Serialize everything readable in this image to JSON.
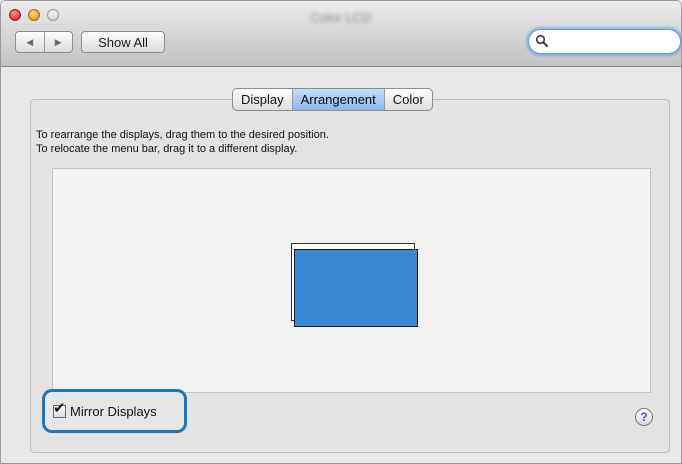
{
  "window": {
    "title": "Color LCD"
  },
  "toolbar": {
    "back_glyph": "◀",
    "forward_glyph": "▶",
    "show_all_label": "Show All",
    "search": {
      "value": "",
      "placeholder": ""
    }
  },
  "tabs": [
    {
      "label": "Display",
      "selected": false
    },
    {
      "label": "Arrangement",
      "selected": true
    },
    {
      "label": "Color",
      "selected": false
    }
  ],
  "instructions": {
    "line1": "To rearrange the displays, drag them to the desired position.",
    "line2": "To relocate the menu bar, drag it to a different display."
  },
  "arrangement": {
    "display_color": "#3b87d3",
    "mirrored": true
  },
  "mirror_displays": {
    "label": "Mirror Displays",
    "checked": true,
    "check_glyph": "✔",
    "highlight_color": "#1d76b8"
  },
  "help": {
    "glyph": "?"
  },
  "icons": {
    "close": "close-icon",
    "minimize": "minimize-icon",
    "zoom": "zoom-icon",
    "search": "search-icon",
    "help": "help-icon"
  }
}
